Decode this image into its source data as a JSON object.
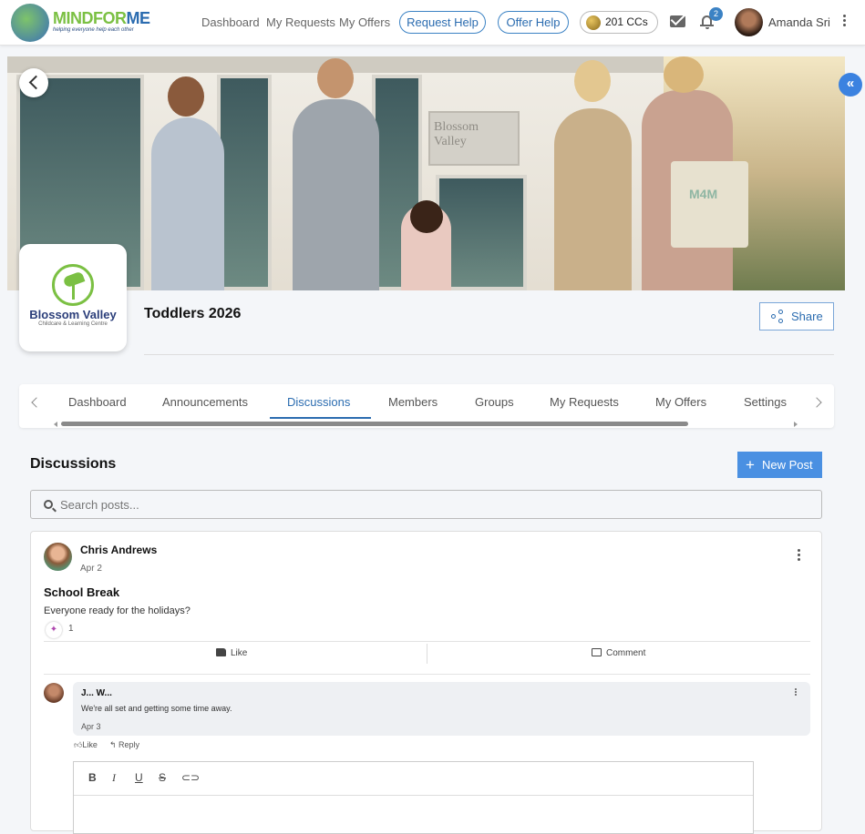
{
  "brand": {
    "word_main": "MINDFOR",
    "word_accent": "ME",
    "tagline": "helping everyone help each other"
  },
  "nav": {
    "links": [
      "Dashboard",
      "My Requests",
      "My Offers"
    ],
    "request_help": "Request Help",
    "offer_help": "Offer Help",
    "credits": "201 CCs",
    "notifications": "2",
    "user_name": "Amanda Sri"
  },
  "hero": {
    "sign_text": "Blossom Valley",
    "bag_text": "M4M"
  },
  "org": {
    "name": "Blossom Valley",
    "subtitle": "Childcare & Learning Centre"
  },
  "group": {
    "title": "Toddlers 2026",
    "share_label": "Share"
  },
  "tabs": [
    "Dashboard",
    "Announcements",
    "Discussions",
    "Members",
    "Groups",
    "My Requests",
    "My Offers",
    "Settings"
  ],
  "discussions": {
    "title": "Discussions",
    "new_post": "New Post",
    "search_placeholder": "Search posts..."
  },
  "post": {
    "author": "Chris Andrews",
    "date": "Apr 2",
    "title": "School Break",
    "body": "Everyone ready for the holidays?",
    "reaction_count": "1",
    "like_label": "Like",
    "comment_label": "Comment"
  },
  "comment": {
    "author": "J... W...",
    "text": "We're all set and getting some time away.",
    "date": "Apr 3",
    "like_label": "Like",
    "reply_label": "Reply"
  },
  "editor": {
    "tools": [
      "B",
      "I",
      "U",
      "S"
    ]
  },
  "colors": {
    "accent": "#2b6cb0",
    "brand_green": "#7bc043",
    "primary_button": "#4a90e2"
  }
}
